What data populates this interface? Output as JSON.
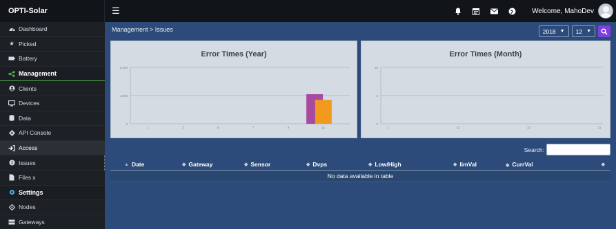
{
  "app": {
    "brand": "OPTI-Solar",
    "welcome": "Welcome, MahoDev"
  },
  "topbar": {
    "icons": [
      "bell-icon",
      "calendar-icon",
      "envelope-icon",
      "globe-icon"
    ]
  },
  "sidebar": {
    "items": [
      {
        "label": "Dashboard",
        "icon": "dashboard-icon",
        "type": "item"
      },
      {
        "label": "Picked",
        "icon": "star-icon",
        "type": "item"
      },
      {
        "label": "Battery",
        "icon": "battery-icon",
        "type": "item"
      },
      {
        "label": "Management",
        "icon": "share-icon",
        "type": "section"
      },
      {
        "label": "Clients",
        "icon": "clients-icon",
        "type": "item"
      },
      {
        "label": "Devices",
        "icon": "monitor-icon",
        "type": "item"
      },
      {
        "label": "Data",
        "icon": "database-icon",
        "type": "item"
      },
      {
        "label": "API Console",
        "icon": "gear-icon",
        "type": "item"
      },
      {
        "label": "Access",
        "icon": "sign-in-icon",
        "type": "item"
      },
      {
        "label": "Issues",
        "icon": "info-icon",
        "type": "item"
      },
      {
        "label": "Files x",
        "icon": "file-icon",
        "type": "item"
      },
      {
        "label": "Settings",
        "icon": "cog-icon",
        "type": "section"
      },
      {
        "label": "Nodes",
        "icon": "nodes-icon",
        "type": "item"
      },
      {
        "label": "Gateways",
        "icon": "server-icon",
        "type": "item"
      }
    ]
  },
  "breadcrumb": "Management > Issues",
  "filters": {
    "year": "2018",
    "month": "12"
  },
  "charts": {
    "year_title": "Error Times (Year)",
    "month_title": "Error Times (Month)"
  },
  "chart_data": [
    {
      "type": "bar",
      "title": "Error Times (Year)",
      "x_ticks": [
        "1",
        "3",
        "5",
        "7",
        "9",
        "11"
      ],
      "y_ticks": [
        "0",
        "1,000",
        "2,000"
      ],
      "ylim": [
        0,
        2000
      ],
      "bars": [
        {
          "x": 10.5,
          "value": 1050,
          "color": "#a84a9f"
        },
        {
          "x": 11,
          "value": 850,
          "color": "#f29a1e"
        }
      ],
      "grid": true
    },
    {
      "type": "bar",
      "title": "Error Times (Month)",
      "x_ticks": [
        "1",
        "11",
        "21",
        "31"
      ],
      "y_ticks": [
        "0",
        "5",
        "10"
      ],
      "ylim": [
        0,
        10
      ],
      "bars": [],
      "grid": true
    }
  ],
  "table": {
    "search_label": "Search:",
    "columns": [
      "Date",
      "Gateway",
      "Sensor",
      "Dvps",
      "Low/High",
      "limVal",
      "CurrVal"
    ],
    "empty_message": "No data available in table"
  },
  "colors": {
    "accent": "#7e3fe0",
    "management_underline": "#56b04e"
  }
}
